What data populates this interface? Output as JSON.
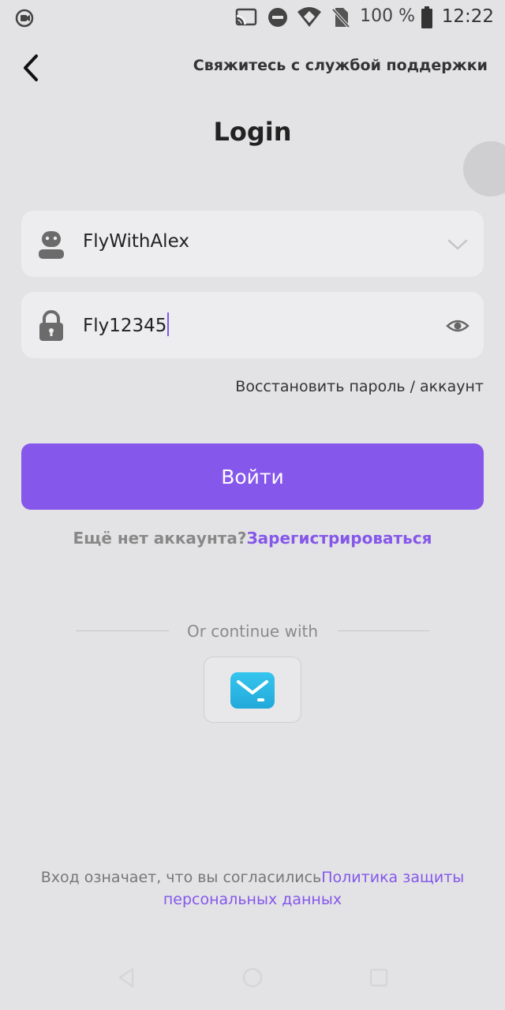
{
  "status_bar": {
    "battery_percent": "100 %",
    "time": "12:22",
    "icons": [
      "screen-record-icon",
      "cast-icon",
      "do-not-disturb-icon",
      "wifi-icon",
      "no-sim-icon",
      "battery-icon"
    ]
  },
  "header": {
    "support_link": "Свяжитесь с службой поддержки",
    "title": "Login"
  },
  "form": {
    "username_value": "FlyWithAlex",
    "password_value": "Fly12345",
    "recover_link": "Восстановить пароль / аккаунт",
    "login_button": "Войти"
  },
  "register": {
    "question": "Ещё нет аккаунта?",
    "link": "Зарегистрироваться"
  },
  "social": {
    "divider_text": "Or continue with",
    "provider_icon": "mail-app-icon"
  },
  "legal": {
    "text": "Вход означает, что вы согласились",
    "link": "Политика защиты персональных данных"
  },
  "colors": {
    "accent": "#8557ea",
    "background": "#e3e3e5",
    "field_bg": "#ededef"
  }
}
